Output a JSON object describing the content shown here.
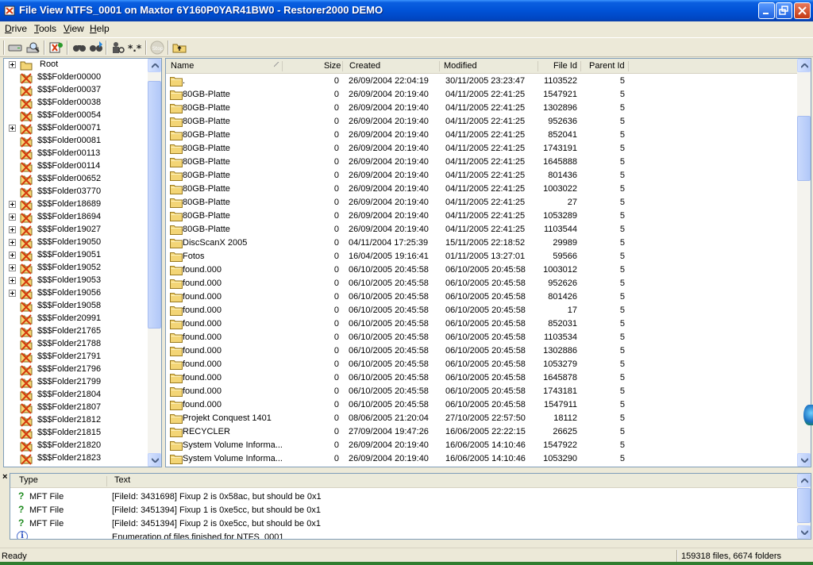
{
  "window": {
    "title": "File View NTFS_0001 on Maxtor 6Y160P0YAR41BW0 - Restorer2000 DEMO"
  },
  "menu": [
    {
      "label": "Drive",
      "accel": "D",
      "rest": "rive"
    },
    {
      "label": "Tools",
      "accel": "T",
      "rest": "ools"
    },
    {
      "label": "View",
      "accel": "V",
      "rest": "iew"
    },
    {
      "label": "Help",
      "accel": "H",
      "rest": "elp"
    }
  ],
  "toolbar": {
    "icons": [
      "drive-icon",
      "scan-icon",
      "recover-icon",
      "find-icon",
      "find-next-icon",
      "find-users-icon",
      "mask-icon",
      "stop-icon",
      "up-folder-icon"
    ]
  },
  "tree": {
    "root_label": "Root",
    "items": [
      {
        "label": "$$$Folder00000",
        "expandable": false
      },
      {
        "label": "$$$Folder00037",
        "expandable": false
      },
      {
        "label": "$$$Folder00038",
        "expandable": false
      },
      {
        "label": "$$$Folder00054",
        "expandable": false
      },
      {
        "label": "$$$Folder00071",
        "expandable": true
      },
      {
        "label": "$$$Folder00081",
        "expandable": false
      },
      {
        "label": "$$$Folder00113",
        "expandable": false
      },
      {
        "label": "$$$Folder00114",
        "expandable": false
      },
      {
        "label": "$$$Folder00652",
        "expandable": false
      },
      {
        "label": "$$$Folder03770",
        "expandable": false
      },
      {
        "label": "$$$Folder18689",
        "expandable": true
      },
      {
        "label": "$$$Folder18694",
        "expandable": true
      },
      {
        "label": "$$$Folder19027",
        "expandable": true
      },
      {
        "label": "$$$Folder19050",
        "expandable": true
      },
      {
        "label": "$$$Folder19051",
        "expandable": true
      },
      {
        "label": "$$$Folder19052",
        "expandable": true
      },
      {
        "label": "$$$Folder19053",
        "expandable": true
      },
      {
        "label": "$$$Folder19056",
        "expandable": true
      },
      {
        "label": "$$$Folder19058",
        "expandable": false
      },
      {
        "label": "$$$Folder20991",
        "expandable": false
      },
      {
        "label": "$$$Folder21765",
        "expandable": false
      },
      {
        "label": "$$$Folder21788",
        "expandable": false
      },
      {
        "label": "$$$Folder21791",
        "expandable": false
      },
      {
        "label": "$$$Folder21796",
        "expandable": false
      },
      {
        "label": "$$$Folder21799",
        "expandable": false
      },
      {
        "label": "$$$Folder21804",
        "expandable": false
      },
      {
        "label": "$$$Folder21807",
        "expandable": false
      },
      {
        "label": "$$$Folder21812",
        "expandable": false
      },
      {
        "label": "$$$Folder21815",
        "expandable": false
      },
      {
        "label": "$$$Folder21820",
        "expandable": false
      },
      {
        "label": "$$$Folder21823",
        "expandable": false
      }
    ]
  },
  "filelist": {
    "columns": {
      "name": "Name",
      "size": "Size",
      "created": "Created",
      "modified": "Modified",
      "file_id": "File Id",
      "parent_id": "Parent Id"
    },
    "rows": [
      {
        "name": ".",
        "size": "0",
        "created": "26/09/2004 22:04:19",
        "modified": "30/11/2005 23:23:47",
        "file_id": "1103522",
        "parent_id": "5"
      },
      {
        "name": "80GB-Platte",
        "size": "0",
        "created": "26/09/2004 20:19:40",
        "modified": "04/11/2005 22:41:25",
        "file_id": "1547921",
        "parent_id": "5"
      },
      {
        "name": "80GB-Platte",
        "size": "0",
        "created": "26/09/2004 20:19:40",
        "modified": "04/11/2005 22:41:25",
        "file_id": "1302896",
        "parent_id": "5"
      },
      {
        "name": "80GB-Platte",
        "size": "0",
        "created": "26/09/2004 20:19:40",
        "modified": "04/11/2005 22:41:25",
        "file_id": "952636",
        "parent_id": "5"
      },
      {
        "name": "80GB-Platte",
        "size": "0",
        "created": "26/09/2004 20:19:40",
        "modified": "04/11/2005 22:41:25",
        "file_id": "852041",
        "parent_id": "5"
      },
      {
        "name": "80GB-Platte",
        "size": "0",
        "created": "26/09/2004 20:19:40",
        "modified": "04/11/2005 22:41:25",
        "file_id": "1743191",
        "parent_id": "5"
      },
      {
        "name": "80GB-Platte",
        "size": "0",
        "created": "26/09/2004 20:19:40",
        "modified": "04/11/2005 22:41:25",
        "file_id": "1645888",
        "parent_id": "5"
      },
      {
        "name": "80GB-Platte",
        "size": "0",
        "created": "26/09/2004 20:19:40",
        "modified": "04/11/2005 22:41:25",
        "file_id": "801436",
        "parent_id": "5"
      },
      {
        "name": "80GB-Platte",
        "size": "0",
        "created": "26/09/2004 20:19:40",
        "modified": "04/11/2005 22:41:25",
        "file_id": "1003022",
        "parent_id": "5"
      },
      {
        "name": "80GB-Platte",
        "size": "0",
        "created": "26/09/2004 20:19:40",
        "modified": "04/11/2005 22:41:25",
        "file_id": "27",
        "parent_id": "5"
      },
      {
        "name": "80GB-Platte",
        "size": "0",
        "created": "26/09/2004 20:19:40",
        "modified": "04/11/2005 22:41:25",
        "file_id": "1053289",
        "parent_id": "5"
      },
      {
        "name": "80GB-Platte",
        "size": "0",
        "created": "26/09/2004 20:19:40",
        "modified": "04/11/2005 22:41:25",
        "file_id": "1103544",
        "parent_id": "5"
      },
      {
        "name": "DiscScanX 2005",
        "size": "0",
        "created": "04/11/2004 17:25:39",
        "modified": "15/11/2005 22:18:52",
        "file_id": "29989",
        "parent_id": "5"
      },
      {
        "name": "Fotos",
        "size": "0",
        "created": "16/04/2005 19:16:41",
        "modified": "01/11/2005 13:27:01",
        "file_id": "59566",
        "parent_id": "5"
      },
      {
        "name": "found.000",
        "size": "0",
        "created": "06/10/2005 20:45:58",
        "modified": "06/10/2005 20:45:58",
        "file_id": "1003012",
        "parent_id": "5"
      },
      {
        "name": "found.000",
        "size": "0",
        "created": "06/10/2005 20:45:58",
        "modified": "06/10/2005 20:45:58",
        "file_id": "952626",
        "parent_id": "5"
      },
      {
        "name": "found.000",
        "size": "0",
        "created": "06/10/2005 20:45:58",
        "modified": "06/10/2005 20:45:58",
        "file_id": "801426",
        "parent_id": "5"
      },
      {
        "name": "found.000",
        "size": "0",
        "created": "06/10/2005 20:45:58",
        "modified": "06/10/2005 20:45:58",
        "file_id": "17",
        "parent_id": "5"
      },
      {
        "name": "found.000",
        "size": "0",
        "created": "06/10/2005 20:45:58",
        "modified": "06/10/2005 20:45:58",
        "file_id": "852031",
        "parent_id": "5"
      },
      {
        "name": "found.000",
        "size": "0",
        "created": "06/10/2005 20:45:58",
        "modified": "06/10/2005 20:45:58",
        "file_id": "1103534",
        "parent_id": "5"
      },
      {
        "name": "found.000",
        "size": "0",
        "created": "06/10/2005 20:45:58",
        "modified": "06/10/2005 20:45:58",
        "file_id": "1302886",
        "parent_id": "5"
      },
      {
        "name": "found.000",
        "size": "0",
        "created": "06/10/2005 20:45:58",
        "modified": "06/10/2005 20:45:58",
        "file_id": "1053279",
        "parent_id": "5"
      },
      {
        "name": "found.000",
        "size": "0",
        "created": "06/10/2005 20:45:58",
        "modified": "06/10/2005 20:45:58",
        "file_id": "1645878",
        "parent_id": "5"
      },
      {
        "name": "found.000",
        "size": "0",
        "created": "06/10/2005 20:45:58",
        "modified": "06/10/2005 20:45:58",
        "file_id": "1743181",
        "parent_id": "5"
      },
      {
        "name": "found.000",
        "size": "0",
        "created": "06/10/2005 20:45:58",
        "modified": "06/10/2005 20:45:58",
        "file_id": "1547911",
        "parent_id": "5"
      },
      {
        "name": "Projekt Conquest 1401",
        "size": "0",
        "created": "08/06/2005 21:20:04",
        "modified": "27/10/2005 22:57:50",
        "file_id": "18112",
        "parent_id": "5"
      },
      {
        "name": "RECYCLER",
        "size": "0",
        "created": "27/09/2004 19:47:26",
        "modified": "16/06/2005 22:22:15",
        "file_id": "26625",
        "parent_id": "5"
      },
      {
        "name": "System Volume Informa...",
        "size": "0",
        "created": "26/09/2004 20:19:40",
        "modified": "16/06/2005 14:10:46",
        "file_id": "1547922",
        "parent_id": "5"
      },
      {
        "name": "System Volume Informa...",
        "size": "0",
        "created": "26/09/2004 20:19:40",
        "modified": "16/06/2005 14:10:46",
        "file_id": "1053290",
        "parent_id": "5"
      }
    ]
  },
  "log": {
    "close_label": "×",
    "columns": {
      "type": "Type",
      "text": "Text"
    },
    "rows": [
      {
        "icon": "question-icon",
        "type": "MFT File",
        "text": "[FileId: 3431698] Fixup 2 is 0x58ac, but should be 0x1"
      },
      {
        "icon": "question-icon",
        "type": "MFT File",
        "text": "[FileId: 3451394] Fixup 1 is 0xe5cc, but should be 0x1"
      },
      {
        "icon": "question-icon",
        "type": "MFT File",
        "text": "[FileId: 3451394] Fixup 2 is 0xe5cc, but should be 0x1"
      },
      {
        "icon": "info-icon",
        "type": "",
        "text": "Enumeration of files finished for NTFS_0001"
      }
    ]
  },
  "status": {
    "left": "Ready",
    "right": "159318 files, 6674 folders"
  },
  "colors": {
    "title_bar": "#0052d6",
    "folder": "#f3d576",
    "deleted_mark": "#d4380d",
    "selection_none": "#ffffff"
  }
}
